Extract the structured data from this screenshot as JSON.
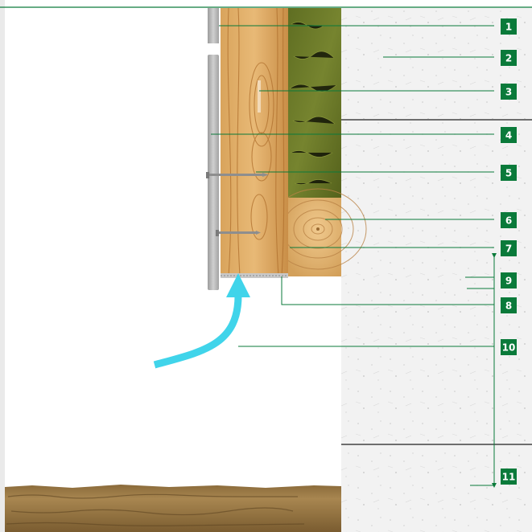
{
  "diagram": {
    "type": "construction cross-section",
    "accent_color": "#0a7a3a",
    "airflow_color": "#40d4ea",
    "callouts": [
      {
        "number": "1"
      },
      {
        "number": "2"
      },
      {
        "number": "3"
      },
      {
        "number": "4"
      },
      {
        "number": "5"
      },
      {
        "number": "6"
      },
      {
        "number": "7"
      },
      {
        "number": "8"
      },
      {
        "number": "9"
      },
      {
        "number": "10"
      },
      {
        "number": "11"
      }
    ]
  }
}
